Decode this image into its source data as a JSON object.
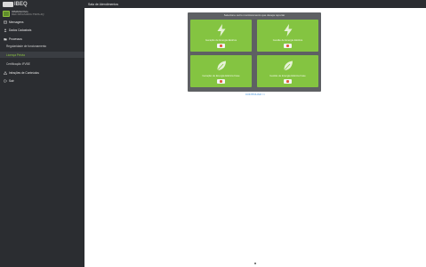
{
  "app": {
    "logo_text": "IBEQ",
    "user_name": "IOMANA Pelo",
    "user_id": "REF.S55AS3004-TSDS-4Q"
  },
  "sidebar": {
    "items": [
      {
        "label": "Mensagens",
        "icon": "mail-icon"
      },
      {
        "label": "Dados Cadastrais",
        "icon": "user-icon"
      },
      {
        "label": "Processos",
        "icon": "folder-icon"
      }
    ],
    "sub_items": [
      {
        "label": "Regularidade de funcionamento",
        "active": false
      },
      {
        "label": "Licença Prévia",
        "active": true
      },
      {
        "label": "Certificação IFVBE",
        "active": false
      }
    ],
    "items_after": [
      {
        "label": "Infrações de Conteúdos",
        "icon": "alert-icon"
      },
      {
        "label": "Sair",
        "icon": "logout-icon"
      }
    ]
  },
  "topbar": {
    "title": "Sala de Atendimentos"
  },
  "panel": {
    "heading": "Selecione outro monitoramento que deseja reportar",
    "cards": [
      {
        "title": "Geração de Energia Elétrica",
        "icon": "lightning-icon"
      },
      {
        "title": "Gestão de Energia Elétrica",
        "icon": "lightning-icon"
      },
      {
        "title": "Geração de Energia Elétrica Fase",
        "icon": "leaf-icon"
      },
      {
        "title": "Gestão de Energia Elétrica Fase",
        "icon": "leaf-icon"
      }
    ]
  },
  "continue_link": "CONTINUAR >>",
  "colors": {
    "sidebar_bg": "#2b2d31",
    "card_green": "#84c441",
    "panel_gray": "#5e6063",
    "active_green": "#8cc63f",
    "link_blue": "#3d8fd9"
  }
}
